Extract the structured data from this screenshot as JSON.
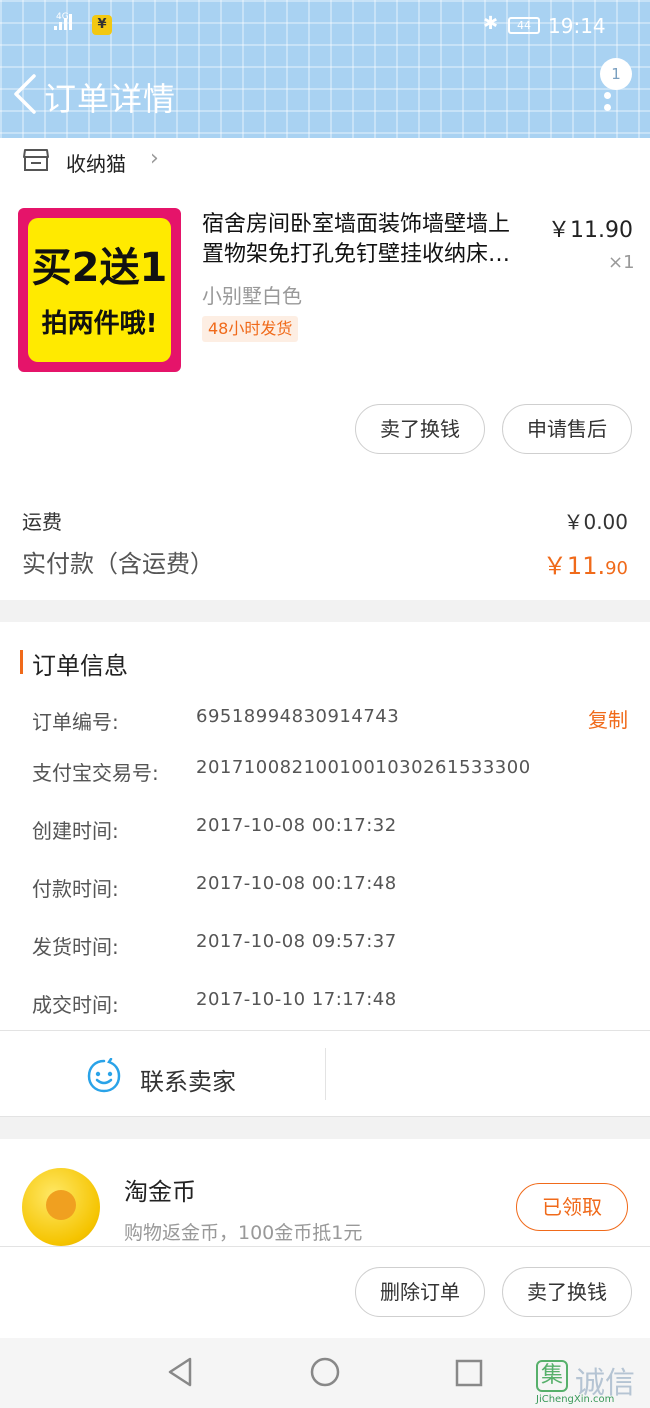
{
  "statusbar": {
    "network": "4G",
    "pay_icon_char": "¥",
    "battery": "44",
    "time": "19:14"
  },
  "nav": {
    "title": "订单详情",
    "badge": "1"
  },
  "shop": {
    "name": "收纳猫"
  },
  "product": {
    "image_text_line1": "买2送1",
    "image_text_line2": "拍两件哦!",
    "title_line1": "宿舍房间卧室墙面装饰墙壁墙上",
    "title_line2": "置物架免打孔免钉壁挂收纳床…",
    "price": "￥11.90",
    "qty": "×1",
    "sku": "小别墅白色",
    "tag": "48小时发货"
  },
  "item_actions": {
    "sell_label": "卖了换钱",
    "aftersale_label": "申请售后"
  },
  "fees": {
    "shipping_label": "运费",
    "shipping_value": "￥0.00",
    "paid_label": "实付款（含运费）",
    "paid_int": "￥11.",
    "paid_dec": "90"
  },
  "order_info": {
    "title": "订单信息",
    "copy_label": "复制",
    "rows": [
      {
        "key": "订单编号:",
        "value": "69518994830914743"
      },
      {
        "key": "支付宝交易号:",
        "value": "2017100821001001030261533300"
      },
      {
        "key": "创建时间:",
        "value": "2017-10-08 00:17:32"
      },
      {
        "key": "付款时间:",
        "value": "2017-10-08 00:17:48"
      },
      {
        "key": "发货时间:",
        "value": "2017-10-08 09:57:37"
      },
      {
        "key": "成交时间:",
        "value": "2017-10-10 17:17:48"
      }
    ]
  },
  "contact": {
    "label": "联系卖家"
  },
  "coin": {
    "title": "淘金币",
    "desc": "购物返金币，100金币抵1元",
    "button": "已领取"
  },
  "bottom_actions": {
    "delete_label": "删除订单",
    "sell_label": "卖了换钱"
  },
  "watermark": {
    "char": "集",
    "text": "诚信",
    "url": "JiChengXin.com"
  },
  "colors": {
    "accent": "#f06a1a",
    "header": "#a9d2f2"
  }
}
